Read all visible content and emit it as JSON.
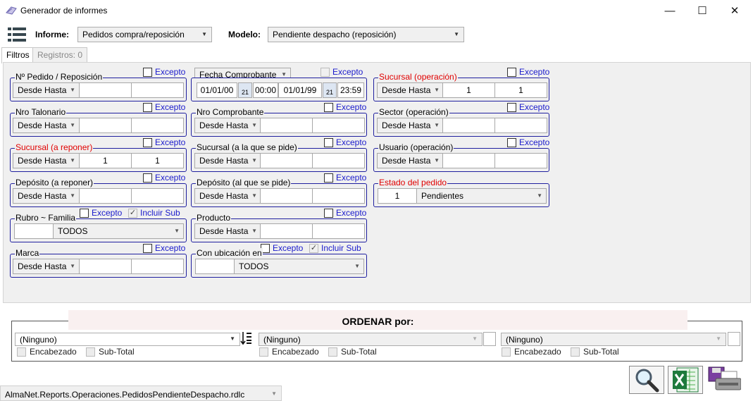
{
  "window": {
    "title": "Generador de informes",
    "min": "—",
    "max": "☐",
    "close": "✕"
  },
  "top": {
    "informe_label": "Informe:",
    "informe_value": "Pedidos compra/reposición",
    "modelo_label": "Modelo:",
    "modelo_value": "Pendiente despacho (reposición)"
  },
  "tabs": [
    {
      "label": "Filtros"
    },
    {
      "label": "Registros: 0"
    }
  ],
  "excepto": "Excepto",
  "incluir_sub": "Incluir Sub",
  "desde_hasta": "Desde Hasta",
  "filters": {
    "nro_pedido": {
      "label": "Nº Pedido / Reposición"
    },
    "nro_talonario": {
      "label": "Nro Talonario"
    },
    "sucursal_reponer": {
      "label": "Sucursal (a reponer)",
      "from": "1",
      "to": "1"
    },
    "deposito_reponer": {
      "label": "Depósito (a reponer)"
    },
    "rubro_familia": {
      "label": "Rubro ~ Familia",
      "value": "TODOS"
    },
    "marca": {
      "label": "Marca"
    },
    "fecha": {
      "type": "Fecha Comprobante",
      "date_from": "01/01/00",
      "day_from": "21",
      "time_from": "00:00",
      "date_to": "01/01/99",
      "day_to": "21",
      "time_to": "23:59"
    },
    "nro_comprobante": {
      "label": "Nro Comprobante"
    },
    "sucursal_pide": {
      "label": "Sucursal (a la que se pide)"
    },
    "deposito_pide": {
      "label": "Depósito (al que se pide)"
    },
    "producto": {
      "label": "Producto"
    },
    "ubicacion": {
      "label": "Con ubicación en",
      "value": "TODOS"
    },
    "sucursal_operacion": {
      "label": "Sucursal (operación)",
      "from": "1",
      "to": "1"
    },
    "sector_operacion": {
      "label": "Sector (operación)"
    },
    "usuario_operacion": {
      "label": "Usuario (operación)"
    },
    "estado_pedido": {
      "label": "Estado del pedido",
      "code": "1",
      "value": "Pendientes"
    }
  },
  "ordenar": {
    "title": "ORDENAR  por:",
    "slots": [
      {
        "value": "(Ninguno)"
      },
      {
        "value": "(Ninguno)"
      },
      {
        "value": "(Ninguno)"
      }
    ],
    "encabezado": "Encabezado",
    "subtotal": "Sub-Total"
  },
  "status": {
    "file": "AlmaNet.Reports.Operaciones.PedidosPendienteDespacho.rdlc"
  },
  "icons": {
    "app": "report-icon",
    "menu": "list-menu-icon",
    "search": "magnifier-icon",
    "excel": "excel-icon",
    "print": "printer-icon"
  }
}
